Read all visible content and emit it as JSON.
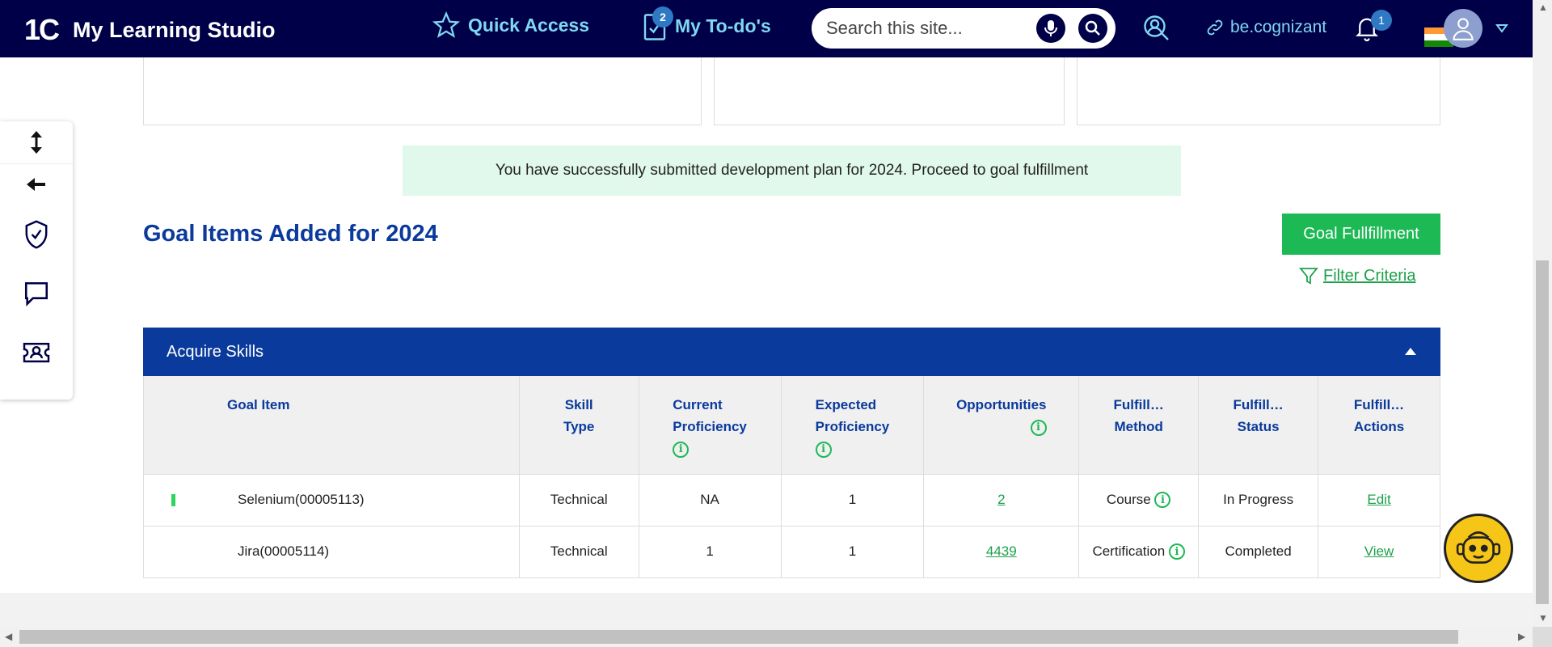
{
  "header": {
    "logo": "1C",
    "title": "My Learning Studio",
    "quick_access": "Quick Access",
    "todos": "My To-do's",
    "todo_badge": "2",
    "search_placeholder": "Search this site...",
    "link_label": "be.cognizant",
    "notif_badge": "1",
    "colors": {
      "bg": "#000048",
      "accent": "#7fd8f0"
    }
  },
  "side_rail": {
    "icons": [
      "expand-vertical-icon",
      "back-arrow-icon",
      "shield-check-icon",
      "chat-icon",
      "ticket-icon"
    ]
  },
  "banner": {
    "message": "You have successfully submitted development plan for 2024. Proceed to goal fulfillment"
  },
  "page": {
    "title": "Goal Items Added for 2024",
    "goal_button": "Goal Fullfillment",
    "filter_label": "Filter Criteria"
  },
  "section": {
    "title": "Acquire Skills"
  },
  "table": {
    "headers": {
      "goal_item": "Goal Item",
      "skill_type_1": "Skill",
      "skill_type_2": "Type",
      "current_1": "Current",
      "current_2": "Proficiency",
      "expected_1": "Expected",
      "expected_2": "Proficiency",
      "opportunities": "Opportunities",
      "method_1": "Fulfill…",
      "method_2": "Method",
      "status_1": "Fulfill…",
      "status_2": "Status",
      "actions_1": "Fulfill…",
      "actions_2": "Actions"
    },
    "rows": [
      {
        "goal": "Selenium(00005113)",
        "type": "Technical",
        "current": "NA",
        "expected": "1",
        "opportunities": "2",
        "method": "Course",
        "status": "In Progress",
        "action": "Edit"
      },
      {
        "goal": "Jira(00005114)",
        "type": "Technical",
        "current": "1",
        "expected": "1",
        "opportunities": "4439",
        "method": "Certification",
        "status": "Completed",
        "action": "View"
      }
    ]
  }
}
